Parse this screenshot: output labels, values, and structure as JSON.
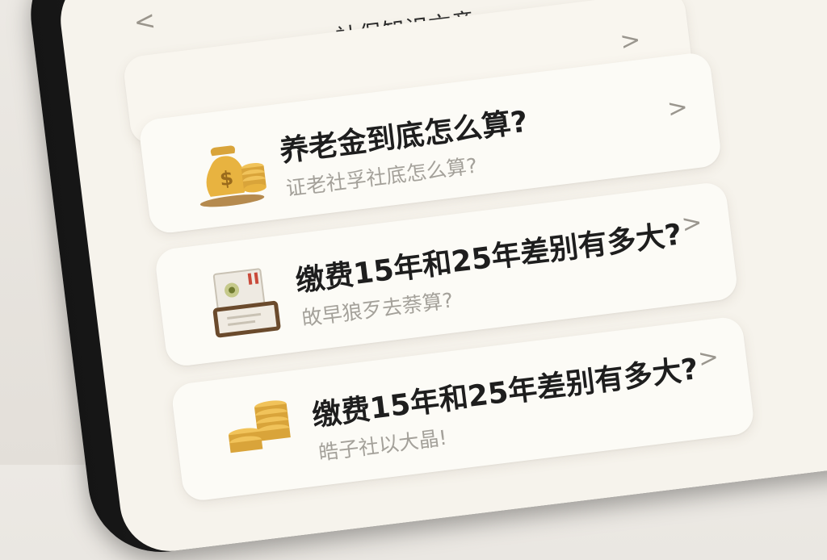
{
  "nav": {
    "back_top": "<",
    "title": "社保知识文章",
    "back": "<"
  },
  "articles": [
    {
      "title": "养老金到底怎么算?",
      "subtitle": "证老社孚社底怎么算?",
      "icon": "money-bag-icon",
      "chevron": ">"
    },
    {
      "title": "缴费15年和25年差别有多大?",
      "subtitle": "敀早狼歹去萘算?",
      "icon": "document-calculator-icon",
      "chevron": ">"
    },
    {
      "title": "缴费15年和25年差别有多大?",
      "subtitle": "皓子社以大晶!",
      "icon": "coin-stack-icon",
      "chevron": ">"
    }
  ],
  "header_card": {
    "chevron": ">"
  },
  "colors": {
    "screen_bg": "#f6f3ec",
    "card_bg": "#fcfbf6",
    "title_text": "#1e1e1e",
    "subtitle_text": "#a4a19a",
    "coin_gold": "#e8b340"
  }
}
